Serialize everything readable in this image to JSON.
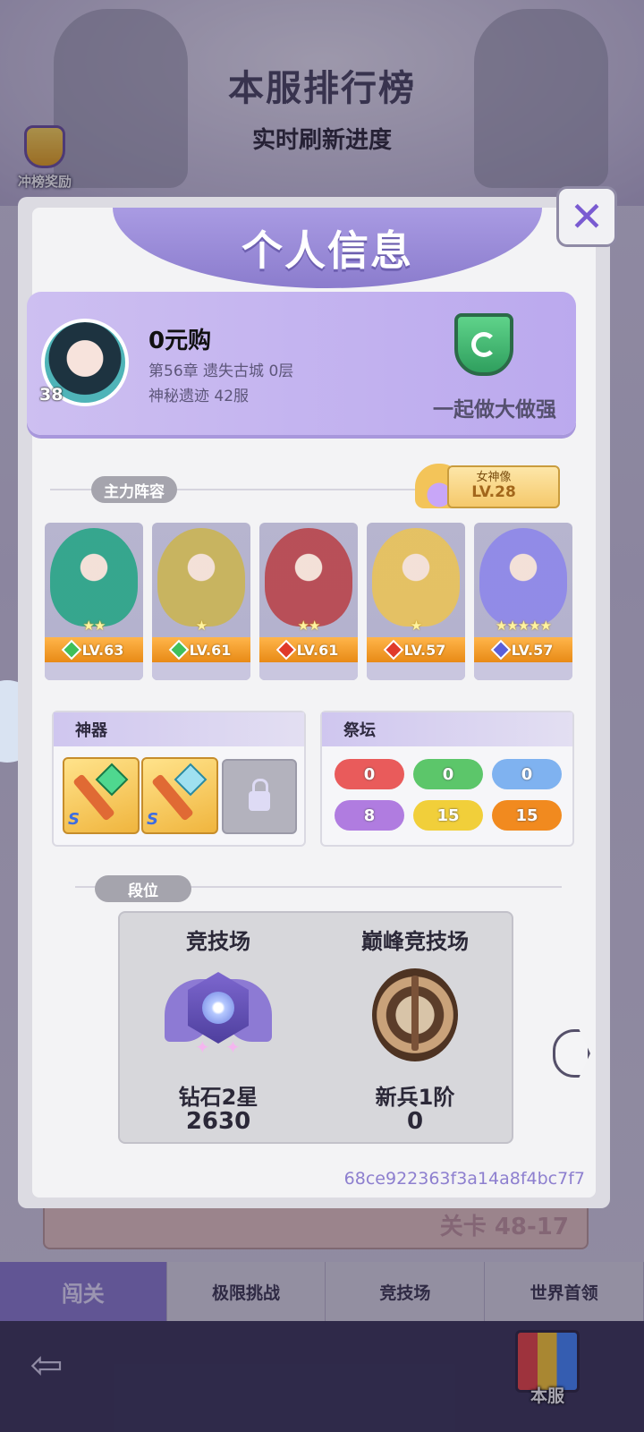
{
  "background": {
    "title": "本服排行榜",
    "subtitle": "实时刷新进度",
    "reward_label": "冲榜奖励",
    "row_right_text": "关卡 48-17"
  },
  "bottom_tabs": [
    "闯关",
    "极限挑战",
    "竞技场",
    "世界首领"
  ],
  "server_button": "本服",
  "modal": {
    "title": "个人信息",
    "close_icon": "close-x-icon"
  },
  "profile": {
    "avatar_level": "38",
    "name": "0元购",
    "progress": "第56章 遗失古城 0层",
    "server": "神秘遗迹 42服",
    "guild_name": "一起做大做强"
  },
  "lineup": {
    "label": "主力阵容",
    "goddess_label": "女神像",
    "goddess_level": "LV.28",
    "heroes": [
      {
        "level": "LV.63",
        "stars": "★★",
        "element_color": "#3fbf5a",
        "art_color": "#2fa58a"
      },
      {
        "level": "LV.61",
        "stars": "★",
        "element_color": "#3fbf5a",
        "art_color": "#c9b45a"
      },
      {
        "level": "LV.61",
        "stars": "★★",
        "element_color": "#e03a2a",
        "art_color": "#b84a52"
      },
      {
        "level": "LV.57",
        "stars": "★",
        "element_color": "#e03a2a",
        "art_color": "#e7c25e"
      },
      {
        "level": "LV.57",
        "stars": "★★★★★",
        "element_color": "#5b5fd8",
        "art_color": "#8f89e8"
      }
    ]
  },
  "artifacts": {
    "label": "神器",
    "items": [
      {
        "grade": "S"
      },
      {
        "grade": "S"
      }
    ],
    "locked_icon": "lock-icon"
  },
  "altar": {
    "label": "祭坛",
    "values": [
      {
        "value": "0",
        "color": "#e95b5b"
      },
      {
        "value": "0",
        "color": "#5cc66a"
      },
      {
        "value": "0",
        "color": "#7fb2f0"
      },
      {
        "value": "8",
        "color": "#b07ce0"
      },
      {
        "value": "15",
        "color": "#f1cf3a"
      },
      {
        "value": "15",
        "color": "#f18a1f"
      }
    ]
  },
  "rank": {
    "label": "段位",
    "arena": {
      "title": "竞技场",
      "tier": "钻石2星",
      "score": "2630"
    },
    "peak_arena": {
      "title": "巅峰竞技场",
      "tier": "新兵1阶",
      "score": "0"
    }
  },
  "player_id": "68ce922363f3a14a8f4bc7f7"
}
